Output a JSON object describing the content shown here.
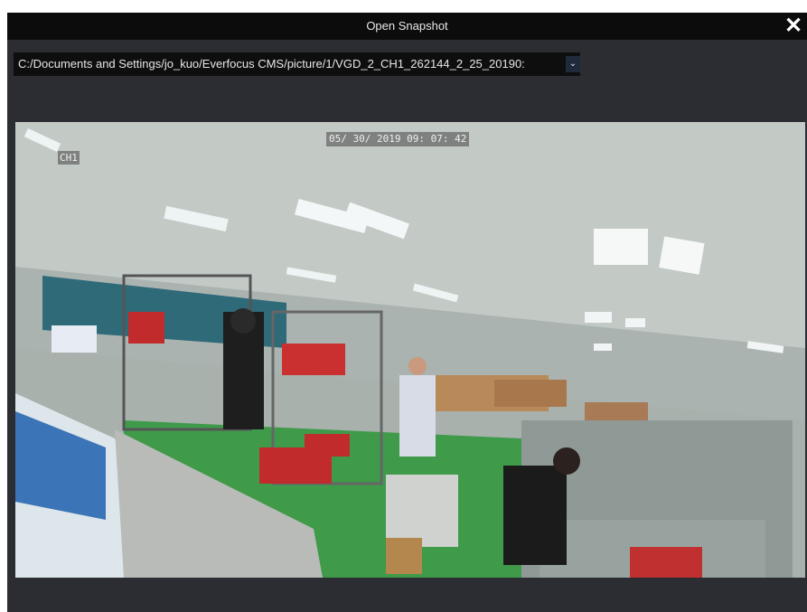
{
  "dialog": {
    "title": "Open Snapshot",
    "close_glyph": "✕"
  },
  "path_select": {
    "value": "C:/Documents and Settings/jo_kuo/Everfocus CMS/picture/1/VGD_2_CH1_262144_2_25_20190:",
    "dropdown_glyph": "⌄"
  },
  "snapshot": {
    "timestamp": "05/ 30/ 2019  09: 07: 42",
    "channel_label": "CH1"
  },
  "colors": {
    "title_bar": "#0c0c0d",
    "dialog_bg": "#2b2d32",
    "path_field": "#0e0e0f"
  }
}
